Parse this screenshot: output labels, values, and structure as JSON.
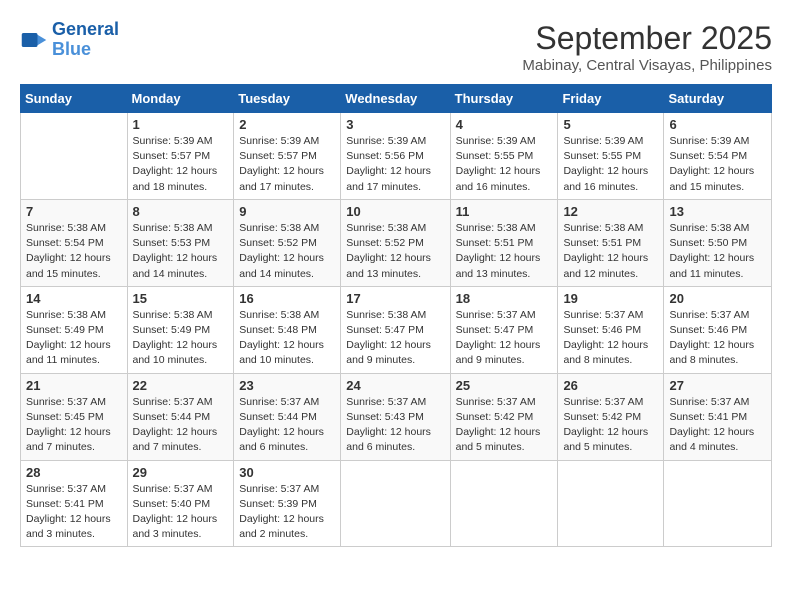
{
  "header": {
    "logo_line1": "General",
    "logo_line2": "Blue",
    "month": "September 2025",
    "location": "Mabinay, Central Visayas, Philippines"
  },
  "weekdays": [
    "Sunday",
    "Monday",
    "Tuesday",
    "Wednesday",
    "Thursday",
    "Friday",
    "Saturday"
  ],
  "weeks": [
    [
      {
        "day": "",
        "info": ""
      },
      {
        "day": "1",
        "info": "Sunrise: 5:39 AM\nSunset: 5:57 PM\nDaylight: 12 hours\nand 18 minutes."
      },
      {
        "day": "2",
        "info": "Sunrise: 5:39 AM\nSunset: 5:57 PM\nDaylight: 12 hours\nand 17 minutes."
      },
      {
        "day": "3",
        "info": "Sunrise: 5:39 AM\nSunset: 5:56 PM\nDaylight: 12 hours\nand 17 minutes."
      },
      {
        "day": "4",
        "info": "Sunrise: 5:39 AM\nSunset: 5:55 PM\nDaylight: 12 hours\nand 16 minutes."
      },
      {
        "day": "5",
        "info": "Sunrise: 5:39 AM\nSunset: 5:55 PM\nDaylight: 12 hours\nand 16 minutes."
      },
      {
        "day": "6",
        "info": "Sunrise: 5:39 AM\nSunset: 5:54 PM\nDaylight: 12 hours\nand 15 minutes."
      }
    ],
    [
      {
        "day": "7",
        "info": "Sunrise: 5:38 AM\nSunset: 5:54 PM\nDaylight: 12 hours\nand 15 minutes."
      },
      {
        "day": "8",
        "info": "Sunrise: 5:38 AM\nSunset: 5:53 PM\nDaylight: 12 hours\nand 14 minutes."
      },
      {
        "day": "9",
        "info": "Sunrise: 5:38 AM\nSunset: 5:52 PM\nDaylight: 12 hours\nand 14 minutes."
      },
      {
        "day": "10",
        "info": "Sunrise: 5:38 AM\nSunset: 5:52 PM\nDaylight: 12 hours\nand 13 minutes."
      },
      {
        "day": "11",
        "info": "Sunrise: 5:38 AM\nSunset: 5:51 PM\nDaylight: 12 hours\nand 13 minutes."
      },
      {
        "day": "12",
        "info": "Sunrise: 5:38 AM\nSunset: 5:51 PM\nDaylight: 12 hours\nand 12 minutes."
      },
      {
        "day": "13",
        "info": "Sunrise: 5:38 AM\nSunset: 5:50 PM\nDaylight: 12 hours\nand 11 minutes."
      }
    ],
    [
      {
        "day": "14",
        "info": "Sunrise: 5:38 AM\nSunset: 5:49 PM\nDaylight: 12 hours\nand 11 minutes."
      },
      {
        "day": "15",
        "info": "Sunrise: 5:38 AM\nSunset: 5:49 PM\nDaylight: 12 hours\nand 10 minutes."
      },
      {
        "day": "16",
        "info": "Sunrise: 5:38 AM\nSunset: 5:48 PM\nDaylight: 12 hours\nand 10 minutes."
      },
      {
        "day": "17",
        "info": "Sunrise: 5:38 AM\nSunset: 5:47 PM\nDaylight: 12 hours\nand 9 minutes."
      },
      {
        "day": "18",
        "info": "Sunrise: 5:37 AM\nSunset: 5:47 PM\nDaylight: 12 hours\nand 9 minutes."
      },
      {
        "day": "19",
        "info": "Sunrise: 5:37 AM\nSunset: 5:46 PM\nDaylight: 12 hours\nand 8 minutes."
      },
      {
        "day": "20",
        "info": "Sunrise: 5:37 AM\nSunset: 5:46 PM\nDaylight: 12 hours\nand 8 minutes."
      }
    ],
    [
      {
        "day": "21",
        "info": "Sunrise: 5:37 AM\nSunset: 5:45 PM\nDaylight: 12 hours\nand 7 minutes."
      },
      {
        "day": "22",
        "info": "Sunrise: 5:37 AM\nSunset: 5:44 PM\nDaylight: 12 hours\nand 7 minutes."
      },
      {
        "day": "23",
        "info": "Sunrise: 5:37 AM\nSunset: 5:44 PM\nDaylight: 12 hours\nand 6 minutes."
      },
      {
        "day": "24",
        "info": "Sunrise: 5:37 AM\nSunset: 5:43 PM\nDaylight: 12 hours\nand 6 minutes."
      },
      {
        "day": "25",
        "info": "Sunrise: 5:37 AM\nSunset: 5:42 PM\nDaylight: 12 hours\nand 5 minutes."
      },
      {
        "day": "26",
        "info": "Sunrise: 5:37 AM\nSunset: 5:42 PM\nDaylight: 12 hours\nand 5 minutes."
      },
      {
        "day": "27",
        "info": "Sunrise: 5:37 AM\nSunset: 5:41 PM\nDaylight: 12 hours\nand 4 minutes."
      }
    ],
    [
      {
        "day": "28",
        "info": "Sunrise: 5:37 AM\nSunset: 5:41 PM\nDaylight: 12 hours\nand 3 minutes."
      },
      {
        "day": "29",
        "info": "Sunrise: 5:37 AM\nSunset: 5:40 PM\nDaylight: 12 hours\nand 3 minutes."
      },
      {
        "day": "30",
        "info": "Sunrise: 5:37 AM\nSunset: 5:39 PM\nDaylight: 12 hours\nand 2 minutes."
      },
      {
        "day": "",
        "info": ""
      },
      {
        "day": "",
        "info": ""
      },
      {
        "day": "",
        "info": ""
      },
      {
        "day": "",
        "info": ""
      }
    ]
  ]
}
